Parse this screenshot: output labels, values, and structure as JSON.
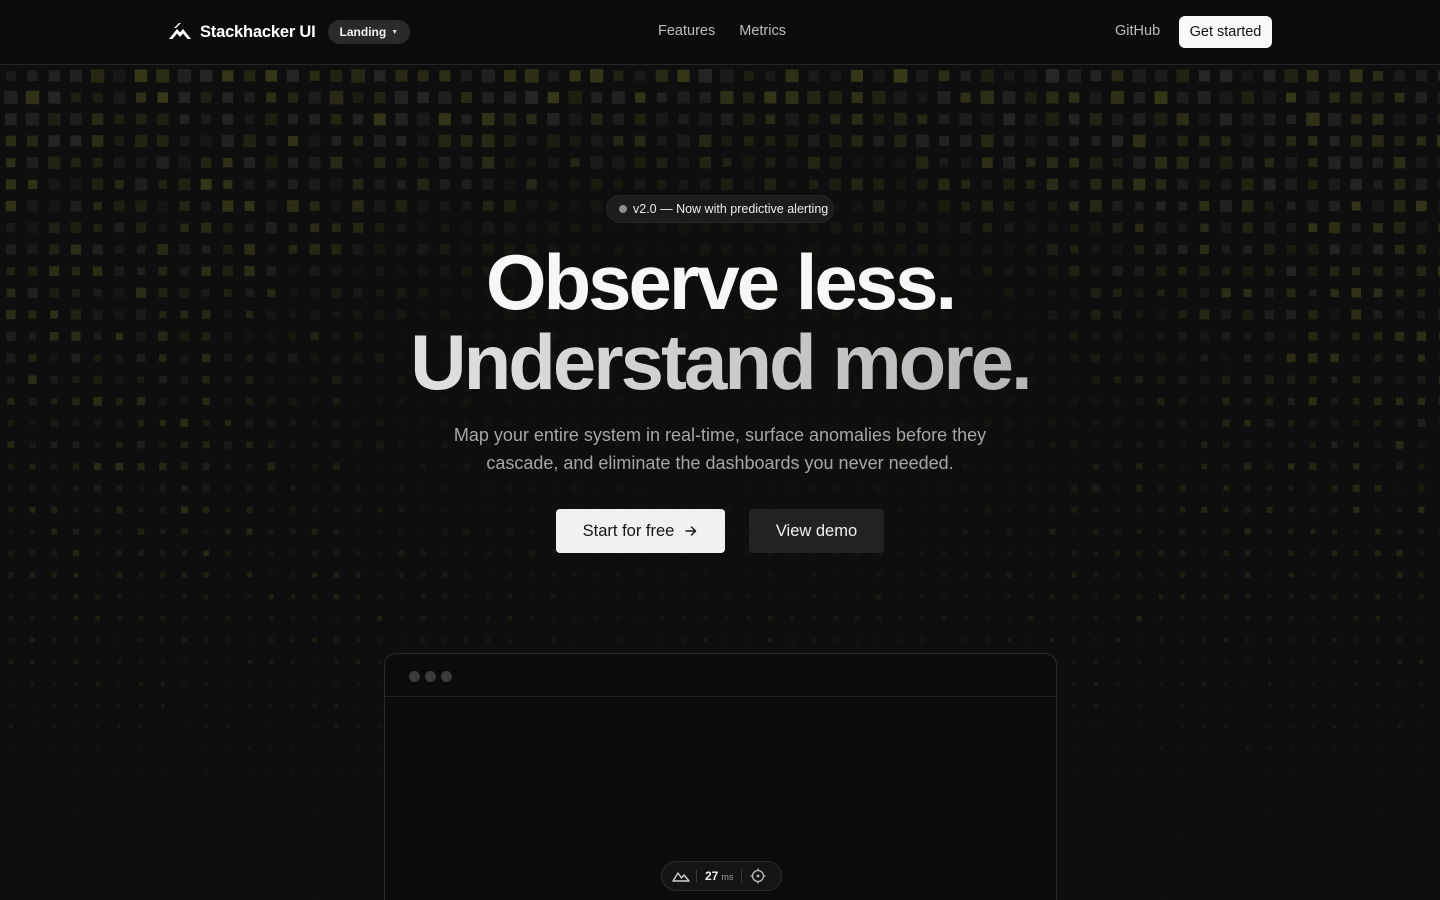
{
  "nav": {
    "brand_name": "Stackhacker UI",
    "brand_pill": "Landing",
    "links": [
      "Features",
      "Metrics"
    ],
    "github": "GitHub",
    "cta": "Get started"
  },
  "hero": {
    "badge": "v2.0 — Now with predictive alerting",
    "headline_line1": "Observe less.",
    "headline_line2": "Understand more.",
    "subtext": "Map your entire system in real-time, surface anomalies before they cascade, and eliminate the dashboards you never needed.",
    "primary_button": "Start for free",
    "secondary_button": "View demo"
  },
  "preview": {
    "latency_value": "27",
    "latency_unit": "ms"
  },
  "colors": {
    "background": "#0e0e0e",
    "grid_tint": "#5a5c22",
    "primary_button": "#f1f1f1",
    "secondary_button": "#222222"
  }
}
